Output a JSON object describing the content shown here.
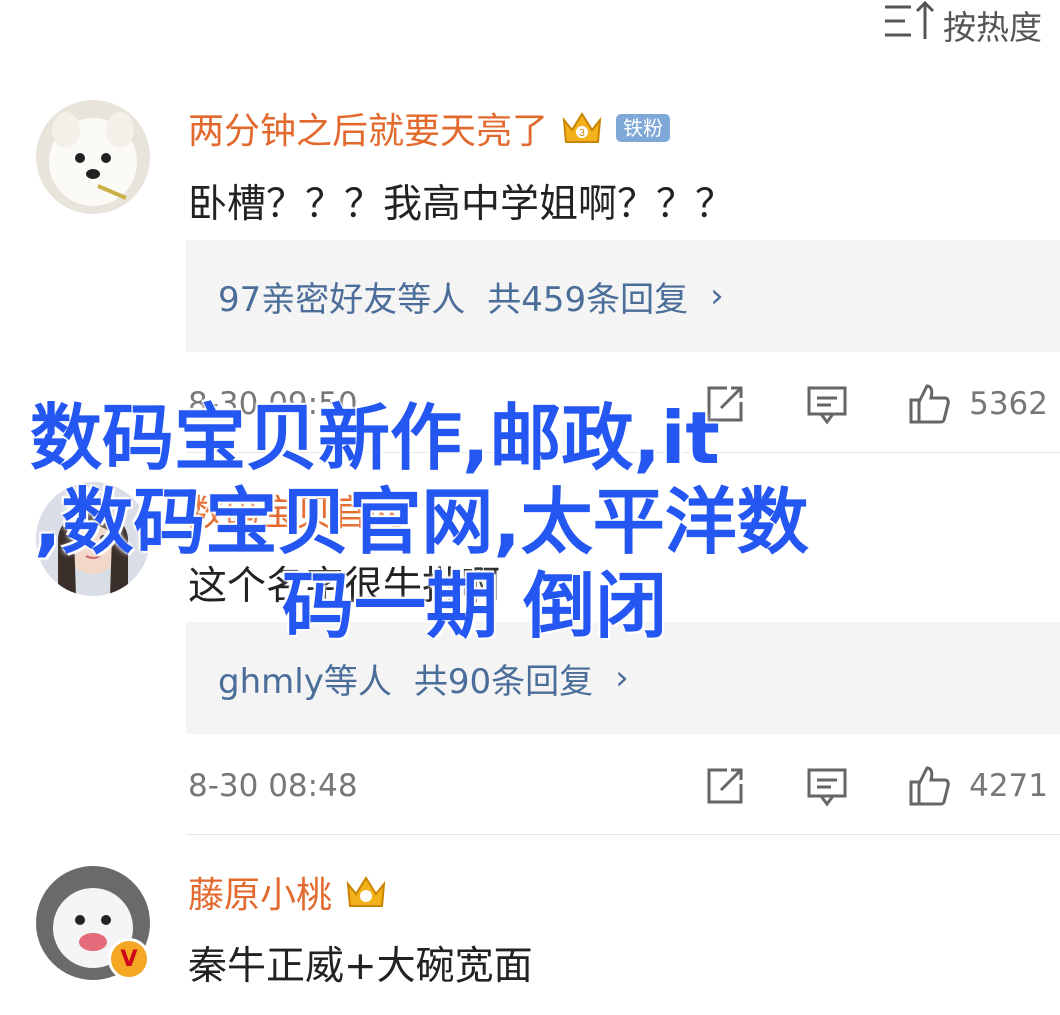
{
  "sort": {
    "label": "按热度"
  },
  "comments": [
    {
      "username": "两分钟之后就要天亮了",
      "badge": "铁粉",
      "text": "卧槽？？？我高中学姐啊？？？",
      "reply_summary": {
        "names": "97亲密好友等人",
        "count": "共459条回复",
        "chevron": "›"
      },
      "time": "8-30 09:50",
      "likes": "5362"
    },
    {
      "username": "数码宝贝官网",
      "text": "这个名字很牛批啊",
      "reply_summary": {
        "names": "ghmly等人",
        "count": "共90条回复",
        "chevron": "›"
      },
      "time": "8-30 08:48",
      "likes": "4271"
    },
    {
      "username": "藤原小桃",
      "text": "秦牛正威+大碗宽面",
      "verified_mark": "V"
    }
  ],
  "overlay": {
    "line1": "数码宝贝新作,邮政,it",
    "line2": ",数码宝贝官网,太平洋数",
    "line3": "码一期 倒闭"
  },
  "colors": {
    "username": "#e36a2e",
    "reply_link": "#4a6d99",
    "overlay_text": "#2457f2",
    "badge": "#7fa8d8"
  },
  "icons": [
    "sort-icon",
    "crown-icon",
    "repost-icon",
    "comment-icon",
    "like-icon"
  ]
}
